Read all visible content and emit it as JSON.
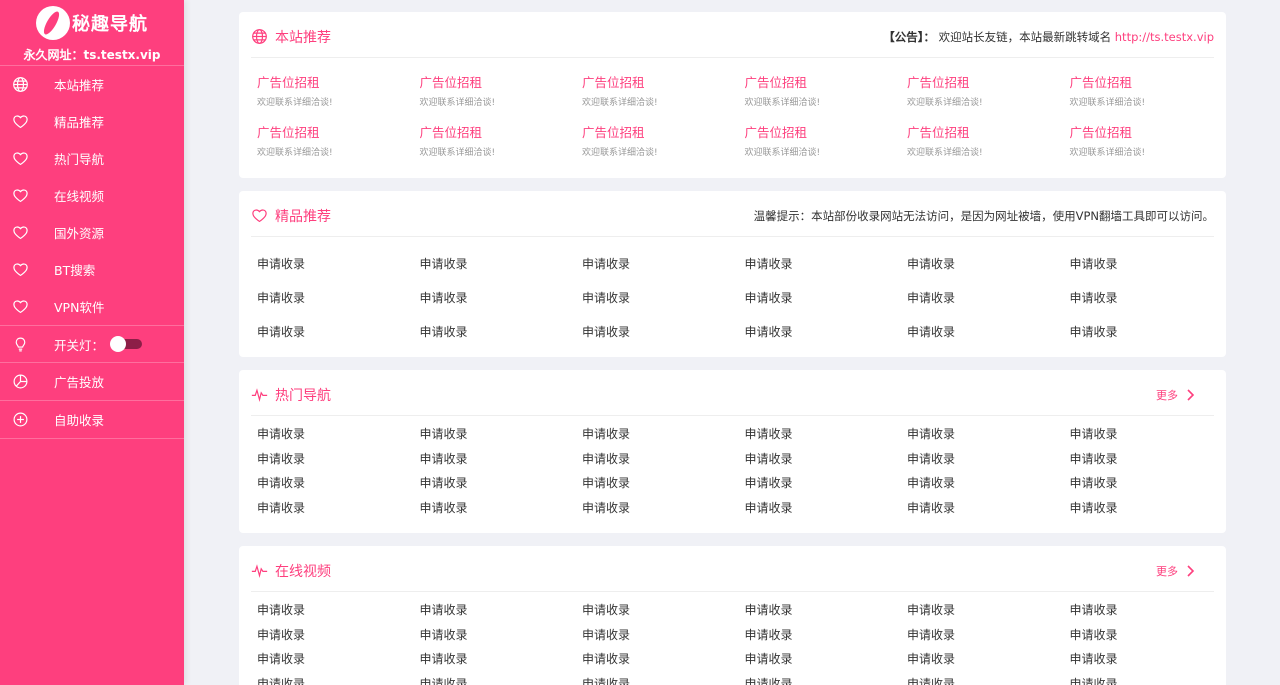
{
  "brand": {
    "title": "秘趣导航",
    "url_label": "永久网址：ts.testx.vip"
  },
  "sidebar": {
    "items": [
      {
        "label": "本站推荐",
        "icon": "globe-icon"
      },
      {
        "label": "精品推荐",
        "icon": "heart-icon"
      },
      {
        "label": "热门导航",
        "icon": "heart-icon"
      },
      {
        "label": "在线视频",
        "icon": "heart-icon"
      },
      {
        "label": "国外资源",
        "icon": "heart-icon"
      },
      {
        "label": "BT搜索",
        "icon": "heart-icon"
      },
      {
        "label": "VPN软件",
        "icon": "heart-icon"
      }
    ],
    "toggle_label": "开关灯：",
    "ad_label": "广告投放",
    "submit_label": "自助收录"
  },
  "sections": {
    "recommend": {
      "title": "本站推荐",
      "notice_prefix": "【公告】：",
      "notice_text": "欢迎站长友链，本站最新跳转域名",
      "notice_link": "http://ts.testx.vip",
      "ad_title": "广告位招租",
      "ad_sub": "欢迎联系详细洽谈!"
    },
    "premium": {
      "title": "精品推荐",
      "notice": "温馨提示：本站部份收录网站无法访问，是因为网址被墙，使用VPN翻墙工具即可以访问。"
    },
    "hot": {
      "title": "热门导航",
      "more": "更多"
    },
    "video": {
      "title": "在线视频",
      "more": "更多"
    },
    "link_label": "申请收录"
  },
  "colors": {
    "accent": "#fe3f7e",
    "background": "#f0f1f6"
  }
}
